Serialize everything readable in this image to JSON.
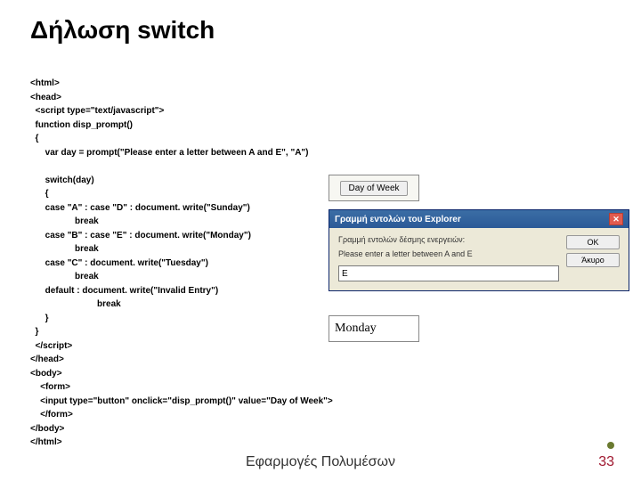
{
  "title": "Δήλωση switch",
  "code": "<html>\n<head>\n  <script type=\"text/javascript\">\n  function disp_prompt()\n  {\n      var day = prompt(\"Please enter a letter between A and E\", \"A\")\n\n      switch(day)\n      {\n      case \"A\" : case \"D\" : document. write(\"Sunday\")\n                  break\n      case \"B\" : case \"E\" : document. write(\"Monday\")\n                  break\n      case \"C\" : document. write(\"Tuesday\")\n                  break\n      default : document. write(\"Invalid Entry\")\n                           break\n      }\n  }\n  </script>\n</head>\n<body>\n    <form>\n    <input type=\"button\" onclick=\"disp_prompt()\" value=\"Day of Week\">\n    </form>\n</body>\n</html>",
  "button_label": "Day of Week",
  "dialog": {
    "title": "Γραμμή εντολών του Explorer",
    "line1": "Γραμμή εντολών δέσμης ενεργειών:",
    "line2": "Please enter a letter between A and E",
    "input_value": "E",
    "ok": "OK",
    "cancel": "Άκυρο"
  },
  "output": "Monday",
  "footer": "Εφαρμογές Πολυμέσων",
  "page": "33"
}
